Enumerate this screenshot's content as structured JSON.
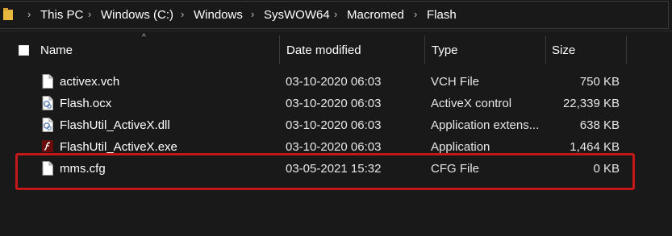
{
  "breadcrumb": {
    "items": [
      "This PC",
      "Windows (C:)",
      "Windows",
      "SysWOW64",
      "Macromed",
      "Flash"
    ],
    "separator": "›"
  },
  "columns": {
    "name": "Name",
    "date": "Date modified",
    "type": "Type",
    "size": "Size"
  },
  "sort_indicator": "^",
  "files": [
    {
      "name": "activex.vch",
      "date": "03-10-2020 06:03",
      "type": "VCH File",
      "size": "750 KB",
      "icon": "document-icon"
    },
    {
      "name": "Flash.ocx",
      "date": "03-10-2020 06:03",
      "type": "ActiveX control",
      "size": "22,339 KB",
      "icon": "gear-document-icon"
    },
    {
      "name": "FlashUtil_ActiveX.dll",
      "date": "03-10-2020 06:03",
      "type": "Application extens...",
      "size": "638 KB",
      "icon": "gear-document-icon"
    },
    {
      "name": "FlashUtil_ActiveX.exe",
      "date": "03-10-2020 06:03",
      "type": "Application",
      "size": "1,464 KB",
      "icon": "flash-app-icon"
    },
    {
      "name": "mms.cfg",
      "date": "03-05-2021 15:32",
      "type": "CFG File",
      "size": "0 KB",
      "icon": "document-icon"
    }
  ],
  "colors": {
    "background": "#191919",
    "text": "#ffffff",
    "highlight_border": "#c41818",
    "folder": "#e8b83e",
    "flash_icon": "#7a0a0a"
  }
}
